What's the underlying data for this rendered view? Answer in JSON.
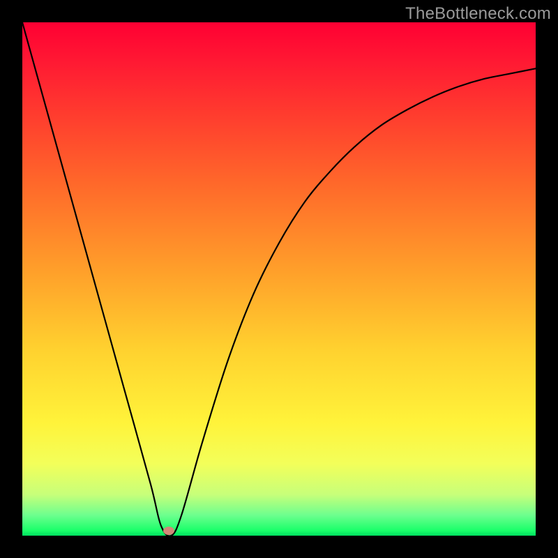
{
  "watermark": "TheBottleneck.com",
  "chart_data": {
    "type": "line",
    "title": "",
    "xlabel": "",
    "ylabel": "",
    "xlim": [
      0,
      100
    ],
    "ylim": [
      0,
      100
    ],
    "grid": false,
    "legend": false,
    "series": [
      {
        "name": "bottleneck-curve",
        "x": [
          0,
          5,
          10,
          15,
          20,
          25,
          27,
          29,
          31,
          35,
          40,
          45,
          50,
          55,
          60,
          65,
          70,
          75,
          80,
          85,
          90,
          95,
          100
        ],
        "values": [
          100,
          82,
          64,
          46,
          28,
          10,
          2,
          0,
          4,
          18,
          34,
          47,
          57,
          65,
          71,
          76,
          80,
          83,
          85.5,
          87.5,
          89,
          90,
          91
        ]
      }
    ],
    "annotations": [
      {
        "name": "selected-point",
        "x": 28.5,
        "y_approx": 1,
        "shape": "ellipse",
        "color": "#d08878"
      }
    ],
    "background_gradient": {
      "top": "#ff0033",
      "mid": "#ffd22f",
      "bottom": "#00e060"
    }
  }
}
